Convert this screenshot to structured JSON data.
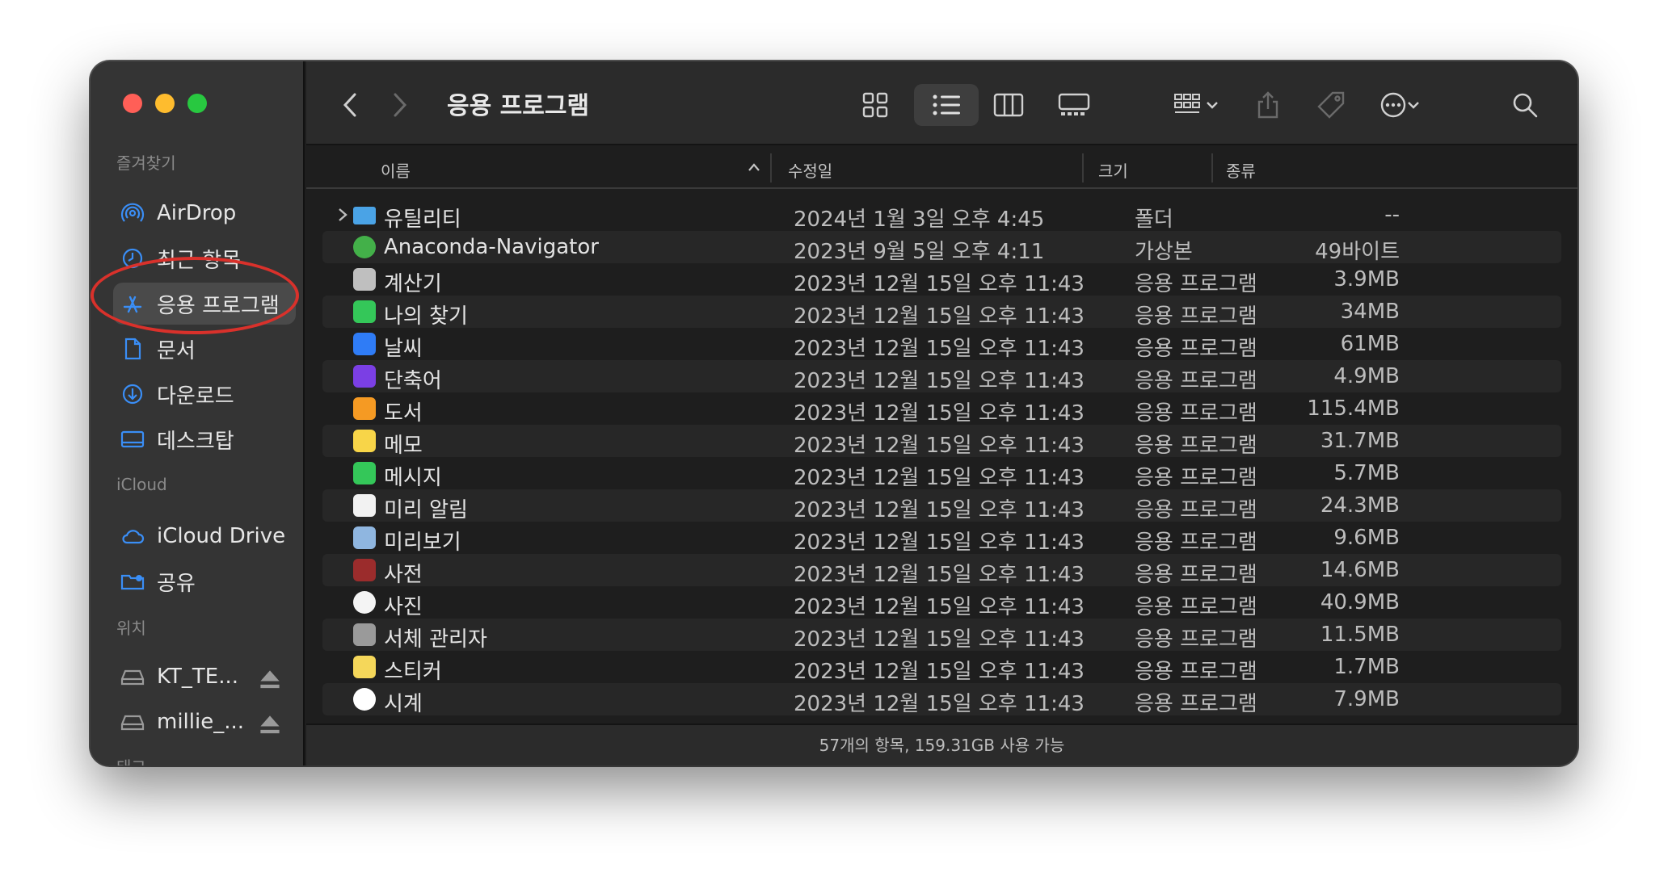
{
  "window": {
    "title": "응용 프로그램"
  },
  "sidebar": {
    "favorites_title": "즐겨찾기",
    "favorites": [
      {
        "label": "AirDrop",
        "icon": "airdrop-icon"
      },
      {
        "label": "최근 항목",
        "icon": "clock-icon"
      },
      {
        "label": "응용 프로그램",
        "icon": "applications-icon",
        "selected": true
      },
      {
        "label": "문서",
        "icon": "document-icon"
      },
      {
        "label": "다운로드",
        "icon": "download-icon"
      },
      {
        "label": "데스크탑",
        "icon": "desktop-icon"
      }
    ],
    "icloud_title": "iCloud",
    "icloud": [
      {
        "label": "iCloud Drive",
        "icon": "cloud-icon"
      },
      {
        "label": "공유",
        "icon": "shared-folder-icon"
      }
    ],
    "locations_title": "위치",
    "locations": [
      {
        "label": "KT_TE...",
        "icon": "drive-icon"
      },
      {
        "label": "millie_...",
        "icon": "drive-icon"
      }
    ],
    "tags_title": "태그"
  },
  "columns": {
    "name": "이름",
    "modified": "수정일",
    "size": "크기",
    "kind": "종류"
  },
  "files": [
    {
      "name": "유틸리티",
      "date": "2024년 1월 3일 오후 4:45",
      "size": "--",
      "kind": "폴더",
      "icon": "folder-icon",
      "color": "#4aa3e6",
      "expandable": true
    },
    {
      "name": "Anaconda-Navigator",
      "date": "2023년 9월 5일 오후 4:11",
      "size": "49바이트",
      "kind": "가상본",
      "icon": "anaconda-icon",
      "color": "#43b049"
    },
    {
      "name": "계산기",
      "date": "2023년 12월 15일 오후 11:43",
      "size": "3.9MB",
      "kind": "응용 프로그램",
      "icon": "calculator-icon",
      "color": "#bfbfbf"
    },
    {
      "name": "나의 찾기",
      "date": "2023년 12월 15일 오후 11:43",
      "size": "34MB",
      "kind": "응용 프로그램",
      "icon": "find-my-icon",
      "color": "#34c759"
    },
    {
      "name": "날씨",
      "date": "2023년 12월 15일 오후 11:43",
      "size": "61MB",
      "kind": "응용 프로그램",
      "icon": "weather-icon",
      "color": "#2f7cf6"
    },
    {
      "name": "단축어",
      "date": "2023년 12월 15일 오후 11:43",
      "size": "4.9MB",
      "kind": "응용 프로그램",
      "icon": "shortcuts-icon",
      "color": "#7b3fe4"
    },
    {
      "name": "도서",
      "date": "2023년 12월 15일 오후 11:43",
      "size": "115.4MB",
      "kind": "응용 프로그램",
      "icon": "books-icon",
      "color": "#f59a23"
    },
    {
      "name": "메모",
      "date": "2023년 12월 15일 오후 11:43",
      "size": "31.7MB",
      "kind": "응용 프로그램",
      "icon": "notes-icon",
      "color": "#f8d548"
    },
    {
      "name": "메시지",
      "date": "2023년 12월 15일 오후 11:43",
      "size": "5.7MB",
      "kind": "응용 프로그램",
      "icon": "messages-icon",
      "color": "#34c759"
    },
    {
      "name": "미리 알림",
      "date": "2023년 12월 15일 오후 11:43",
      "size": "24.3MB",
      "kind": "응용 프로그램",
      "icon": "reminders-icon",
      "color": "#f2f2f2"
    },
    {
      "name": "미리보기",
      "date": "2023년 12월 15일 오후 11:43",
      "size": "9.6MB",
      "kind": "응용 프로그램",
      "icon": "preview-icon",
      "color": "#8fb6e0"
    },
    {
      "name": "사전",
      "date": "2023년 12월 15일 오후 11:43",
      "size": "14.6MB",
      "kind": "응용 프로그램",
      "icon": "dictionary-icon",
      "color": "#9b2c2c"
    },
    {
      "name": "사진",
      "date": "2023년 12월 15일 오후 11:43",
      "size": "40.9MB",
      "kind": "응용 프로그램",
      "icon": "photos-icon",
      "color": "#f4f4f4"
    },
    {
      "name": "서체 관리자",
      "date": "2023년 12월 15일 오후 11:43",
      "size": "11.5MB",
      "kind": "응용 프로그램",
      "icon": "font-book-icon",
      "color": "#9a9a9a"
    },
    {
      "name": "스티커",
      "date": "2023년 12월 15일 오후 11:43",
      "size": "1.7MB",
      "kind": "응용 프로그램",
      "icon": "stickies-icon",
      "color": "#f5d75a"
    },
    {
      "name": "시계",
      "date": "2023년 12월 15일 오후 11:43",
      "size": "7.9MB",
      "kind": "응용 프로그램",
      "icon": "clock-app-icon",
      "color": "#ffffff"
    }
  ],
  "status": {
    "text": "57개의 항목, 159.31GB 사용 가능"
  },
  "colors": {
    "traffic_red": "#ff5f57",
    "traffic_yellow": "#febc2e",
    "traffic_green": "#28c840",
    "accent_blue": "#3a8ef6",
    "annotation_red": "#d9312b"
  }
}
